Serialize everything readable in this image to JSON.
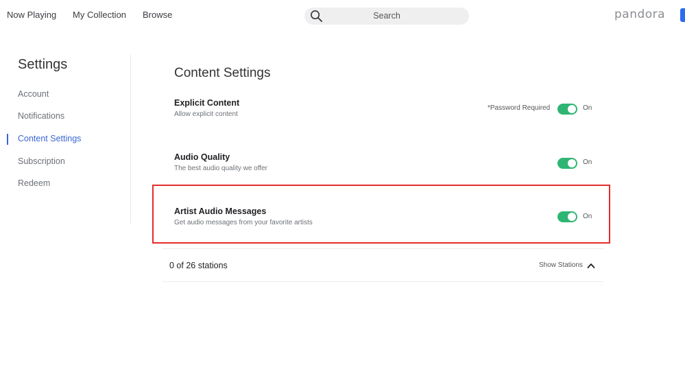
{
  "nav": {
    "links": [
      "Now Playing",
      "My Collection",
      "Browse"
    ],
    "search_placeholder": "Search",
    "logo": "pandora"
  },
  "sidebar": {
    "title": "Settings",
    "items": [
      {
        "label": "Account",
        "active": false
      },
      {
        "label": "Notifications",
        "active": false
      },
      {
        "label": "Content Settings",
        "active": true
      },
      {
        "label": "Subscription",
        "active": false
      },
      {
        "label": "Redeem",
        "active": false
      }
    ]
  },
  "main": {
    "title": "Content Settings",
    "settings": [
      {
        "name": "Explicit Content",
        "description": "Allow explicit content",
        "note": "*Password Required",
        "state": "On"
      },
      {
        "name": "Audio Quality",
        "description": "The best audio quality we offer",
        "state": "On"
      },
      {
        "name": "Artist Audio Messages",
        "description": "Get audio messages from your favorite artists",
        "state": "On"
      }
    ],
    "stations": {
      "count_label": "0 of 26 stations",
      "toggle_label": "Show Stations"
    }
  },
  "colors": {
    "accent": "#3b66d1",
    "toggle_on": "#2eb573",
    "highlight": "#e62b2b"
  }
}
